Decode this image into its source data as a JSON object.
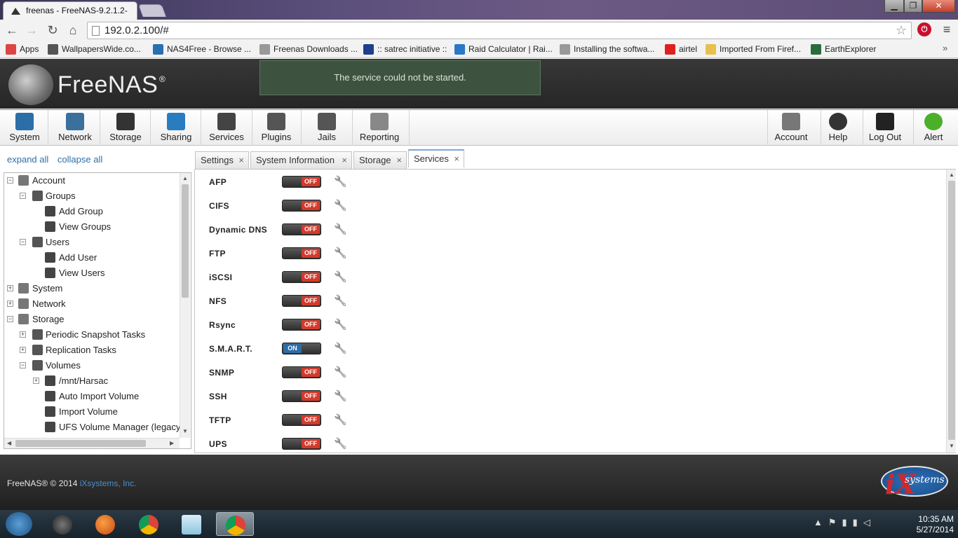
{
  "browser": {
    "tab_title": "freenas - FreeNAS-9.2.1.2-",
    "url": "192.0.2.100/#",
    "bookmarks": [
      {
        "label": "Apps",
        "icon": "apps-grid-icon"
      },
      {
        "label": "WallpapersWide.co...",
        "icon": "wallpaperswide-icon"
      },
      {
        "label": "NAS4Free - Browse ...",
        "icon": "sourceforge-icon"
      },
      {
        "label": "Freenas Downloads ...",
        "icon": "page-icon"
      },
      {
        "label": ":: satrec initiative ::",
        "icon": "satrec-icon"
      },
      {
        "label": "Raid Calculator | Rai...",
        "icon": "raid-calculator-icon"
      },
      {
        "label": "Installing the softwa...",
        "icon": "page-icon"
      },
      {
        "label": "airtel",
        "icon": "airtel-icon"
      },
      {
        "label": "Imported From Firef...",
        "icon": "folder-icon"
      },
      {
        "label": "EarthExplorer",
        "icon": "earthexplorer-icon"
      }
    ],
    "bookmarks_more": "»"
  },
  "header": {
    "logo_text": "FreeNAS",
    "logo_reg": "®",
    "notice": "The service could not be started."
  },
  "topnav": {
    "left": [
      {
        "label": "System",
        "icon": "system-icon"
      },
      {
        "label": "Network",
        "icon": "network-icon"
      },
      {
        "label": "Storage",
        "icon": "storage-icon"
      },
      {
        "label": "Sharing",
        "icon": "sharing-icon"
      },
      {
        "label": "Services",
        "icon": "services-icon"
      },
      {
        "label": "Plugins",
        "icon": "plugins-icon"
      },
      {
        "label": "Jails",
        "icon": "jails-icon"
      },
      {
        "label": "Reporting",
        "icon": "reporting-icon"
      }
    ],
    "right": [
      {
        "label": "Account",
        "icon": "account-icon"
      },
      {
        "label": "Help",
        "icon": "help-icon"
      },
      {
        "label": "Log Out",
        "icon": "logout-icon"
      },
      {
        "label": "Alert",
        "icon": "alert-icon"
      }
    ]
  },
  "tree": {
    "expand_all": "expand all",
    "collapse_all": "collapse all",
    "nodes": [
      {
        "label": "Account",
        "level": 0,
        "expander": "−",
        "icon": "account-icon"
      },
      {
        "label": "Groups",
        "level": 1,
        "expander": "−",
        "icon": "groups-icon"
      },
      {
        "label": "Add Group",
        "level": 2,
        "expander": "",
        "icon": "add-group-icon"
      },
      {
        "label": "View Groups",
        "level": 2,
        "expander": "",
        "icon": "view-groups-icon"
      },
      {
        "label": "Users",
        "level": 1,
        "expander": "−",
        "icon": "users-icon"
      },
      {
        "label": "Add User",
        "level": 2,
        "expander": "",
        "icon": "add-user-icon"
      },
      {
        "label": "View Users",
        "level": 2,
        "expander": "",
        "icon": "view-users-icon"
      },
      {
        "label": "System",
        "level": 0,
        "expander": "+",
        "icon": "system-icon"
      },
      {
        "label": "Network",
        "level": 0,
        "expander": "+",
        "icon": "network-icon"
      },
      {
        "label": "Storage",
        "level": 0,
        "expander": "−",
        "icon": "storage-icon"
      },
      {
        "label": "Periodic Snapshot Tasks",
        "level": 1,
        "expander": "+",
        "icon": "snapshot-icon"
      },
      {
        "label": "Replication Tasks",
        "level": 1,
        "expander": "+",
        "icon": "replication-icon"
      },
      {
        "label": "Volumes",
        "level": 1,
        "expander": "−",
        "icon": "volumes-icon"
      },
      {
        "label": "/mnt/Harsac",
        "level": 2,
        "expander": "+",
        "icon": "volume-icon"
      },
      {
        "label": "Auto Import Volume",
        "level": 2,
        "expander": "",
        "icon": "auto-import-icon"
      },
      {
        "label": "Import Volume",
        "level": 2,
        "expander": "",
        "icon": "import-volume-icon"
      },
      {
        "label": "UFS Volume Manager (legacy)",
        "level": 2,
        "expander": "",
        "icon": "ufs-manager-icon"
      }
    ]
  },
  "tabs": [
    {
      "label": "Settings",
      "active": false
    },
    {
      "label": "System Information",
      "active": false
    },
    {
      "label": "Storage",
      "active": false
    },
    {
      "label": "Services",
      "active": true
    }
  ],
  "tab_close": "×",
  "services": [
    {
      "name": "AFP",
      "state": "OFF"
    },
    {
      "name": "CIFS",
      "state": "OFF"
    },
    {
      "name": "Dynamic DNS",
      "state": "OFF"
    },
    {
      "name": "FTP",
      "state": "OFF"
    },
    {
      "name": "iSCSI",
      "state": "OFF"
    },
    {
      "name": "NFS",
      "state": "OFF"
    },
    {
      "name": "Rsync",
      "state": "OFF"
    },
    {
      "name": "S.M.A.R.T.",
      "state": "ON"
    },
    {
      "name": "SNMP",
      "state": "OFF"
    },
    {
      "name": "SSH",
      "state": "OFF"
    },
    {
      "name": "TFTP",
      "state": "OFF"
    },
    {
      "name": "UPS",
      "state": "OFF"
    }
  ],
  "footer": {
    "text": "FreeNAS® © 2014 ",
    "link": "iXsystems, Inc.",
    "ix_logo_text": "systems",
    "ix_logo_mark": "iX"
  },
  "taskbar": {
    "time": "10:35 AM",
    "date": "5/27/2014"
  },
  "colors": {
    "off": "#d33a2c",
    "on": "#2d6ca6",
    "link": "#2f6fa8",
    "notice_bg": "#3e5240"
  }
}
